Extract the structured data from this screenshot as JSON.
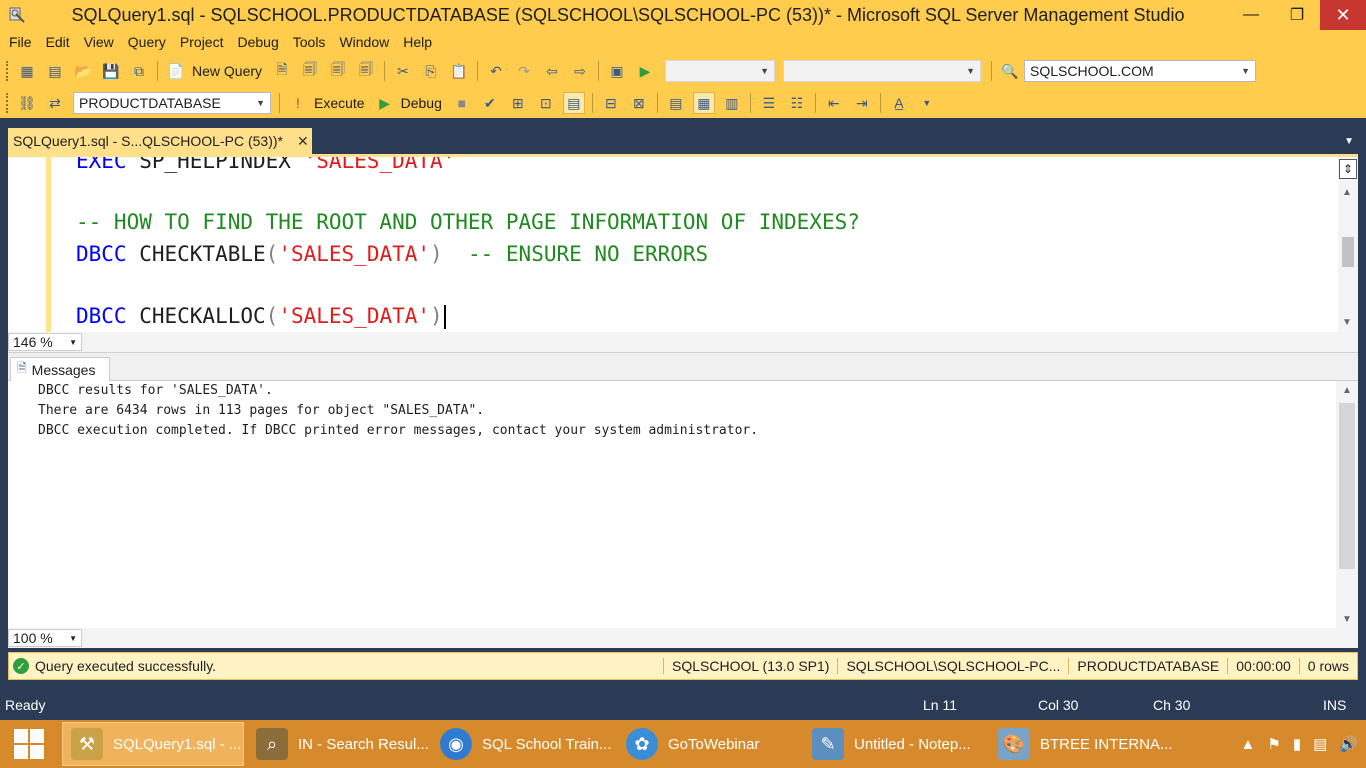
{
  "window": {
    "title": "SQLQuery1.sql - SQLSCHOOL.PRODUCTDATABASE (SQLSCHOOL\\SQLSCHOOL-PC (53))* - Microsoft SQL Server Management Studio",
    "minimize": "—",
    "restore": "❐",
    "close": "✕"
  },
  "menu": {
    "items": [
      "File",
      "Edit",
      "View",
      "Query",
      "Project",
      "Debug",
      "Tools",
      "Window",
      "Help"
    ]
  },
  "toolbar1": {
    "new_query_label": "New Query",
    "server_combo": "SQLSCHOOL.COM"
  },
  "toolbar2": {
    "database_combo": "PRODUCTDATABASE",
    "execute_label": "Execute",
    "debug_label": "Debug"
  },
  "doc_tab": {
    "label": "SQLQuery1.sql - S...QLSCHOOL-PC (53))*",
    "close": "✕"
  },
  "editor": {
    "line1": {
      "kw": "EXEC",
      "rest": " SP_HELPINDEX ",
      "str": "'SALES_DATA'"
    },
    "line2": {
      "comment": "-- HOW TO FIND THE ROOT AND OTHER PAGE INFORMATION OF INDEXES?"
    },
    "line3": {
      "kw": "DBCC",
      "fn": " CHECKTABLE",
      "open": "(",
      "str": "'SALES_DATA'",
      "close": ")",
      "comment": "  -- ENSURE NO ERRORS"
    },
    "line4": {
      "kw": "DBCC",
      "fn": " CHECKALLOC",
      "open": "(",
      "str": "'SALES_DATA'",
      "close": ")"
    },
    "zoom": "146 %"
  },
  "results": {
    "tab_label": "Messages",
    "lines": [
      "DBCC results for 'SALES_DATA'.",
      "There are 6434 rows in 113 pages for object \"SALES_DATA\".",
      "DBCC execution completed. If DBCC printed error messages, contact your system administrator."
    ],
    "zoom": "100 %"
  },
  "query_status": {
    "message": "Query executed successfully.",
    "server": "SQLSCHOOL (13.0 SP1)",
    "login": "SQLSCHOOL\\SQLSCHOOL-PC...",
    "database": "PRODUCTDATABASE",
    "elapsed": "00:00:00",
    "rows": "0 rows"
  },
  "status_bar": {
    "ready": "Ready",
    "ln": "Ln 11",
    "col": "Col 30",
    "ch": "Ch 30",
    "ins": "INS"
  },
  "taskbar": {
    "items": [
      {
        "label": "SQLQuery1.sql - ...",
        "icon": "ssms-icon",
        "color": "#c9a24a"
      },
      {
        "label": "IN - Search Resul...",
        "icon": "search-icon",
        "color": "#8a6d3b"
      },
      {
        "label": "SQL School Train...",
        "icon": "chrome-icon",
        "color": "#2f7bd1"
      },
      {
        "label": "GoToWebinar",
        "icon": "gotowebinar-icon",
        "color": "#3a8ed6"
      },
      {
        "label": "Untitled - Notep...",
        "icon": "notepad-icon",
        "color": "#5c8fc0"
      },
      {
        "label": "BTREE INTERNA...",
        "icon": "paint-icon",
        "color": "#7aa3c8"
      }
    ]
  },
  "colors": {
    "accent": "#ffcc4d",
    "chrome_dark": "#2b3a55",
    "taskbar": "#d68a2b",
    "keyword": "#0000ff",
    "string": "#e01c1c",
    "comment": "#1f8a1f"
  }
}
